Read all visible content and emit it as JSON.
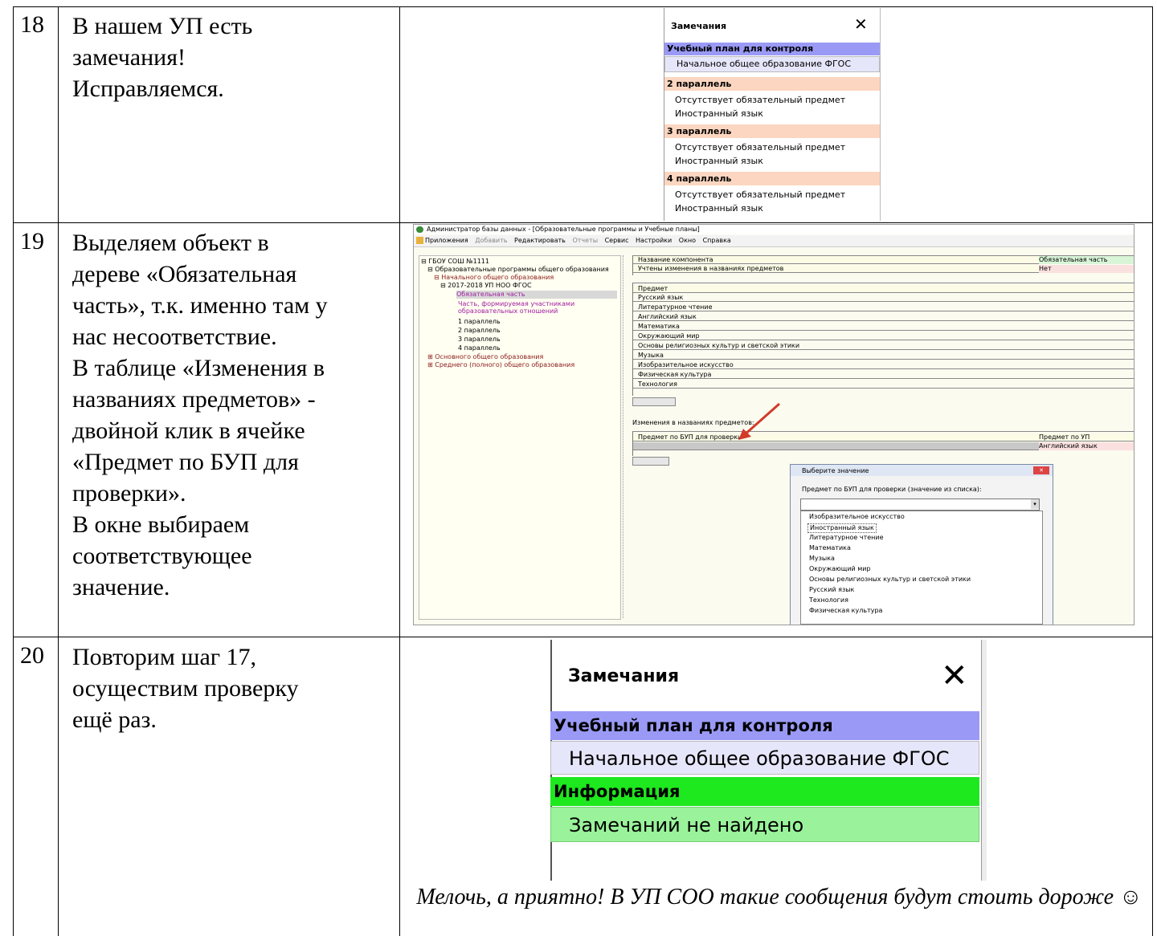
{
  "rows": [
    {
      "number": "18",
      "lines": [
        "В нашем УП есть",
        "замечания!",
        "Исправляемся."
      ]
    },
    {
      "number": "19",
      "lines": [
        "Выделяем объект в",
        "дереве «Обязательная",
        "часть», т.к. именно там у",
        "нас несоответствие.",
        "В таблице «Изменения в",
        "названиях предметов» -",
        "двойной клик в ячейке",
        "«Предмет по БУП для",
        "проверки».",
        "В окне выбираем",
        "соответствующее",
        "значение."
      ]
    },
    {
      "number": "20",
      "lines": [
        "Повторим шаг 17,",
        "осуществим проверку",
        "ещё раз."
      ]
    }
  ],
  "remarks1": {
    "title": "Замечания",
    "close": "✕",
    "plan_header": "Учебный план для контроля",
    "plan_value": "Начальное общее образование ФГОС",
    "groups": [
      {
        "header": "2 параллель",
        "line1": "Отсутствует обязательный предмет",
        "line2": "Иностранный язык"
      },
      {
        "header": "3 параллель",
        "line1": "Отсутствует обязательный предмет",
        "line2": "Иностранный язык"
      },
      {
        "header": "4 параллель",
        "line1": "Отсутствует обязательный предмет",
        "line2": "Иностранный язык"
      }
    ]
  },
  "admin": {
    "title": "Администратор базы данных - [Образовательные программы и Учебные планы]",
    "menu": [
      "Приложения",
      "Добавить",
      "Редактировать",
      "Отчеты",
      "Сервис",
      "Настройки",
      "Окно",
      "Справка"
    ],
    "tree": [
      "⊟ ГБОУ СОШ №1111",
      "⊟ Образовательные программы общего образования",
      "⊟ Начального общего образования",
      "⊟ 2017-2018 УП НОО ФГОС",
      "Обязательная часть",
      "Часть, формируемая участниками",
      "образовательных отношений",
      "1 параллель",
      "2 параллель",
      "3 параллель",
      "4 параллель",
      "⊞ Основного общего образования",
      "⊞ Среднего (полного) общего образования"
    ],
    "props": [
      {
        "name": "Название компонента",
        "value": "Обязательная часть"
      },
      {
        "name": "Учтены изменения в названиях предметов",
        "value": "Нет"
      }
    ],
    "subjects_header": "Предмет",
    "subjects": [
      "Русский язык",
      "Литературное чтение",
      "Английский язык",
      "Математика",
      "Окружающий мир",
      "Основы религиозных культур и светской этики",
      "Музыка",
      "Изобразительное искусство",
      "Физическая культура",
      "Технология"
    ],
    "changes_label": "Изменения в названиях предметов:",
    "changes_col1": "Предмет по БУП для проверки",
    "changes_col2": "Предмет по УП",
    "changes_value2": "Английский язык",
    "dialog_title": "Выберите значение",
    "dialog_label": "Предмет по БУП для проверки (значение из списка):",
    "options": [
      "Изобразительное искусство",
      "Иностранный язык",
      "Литературное чтение",
      "Математика",
      "Музыка",
      "Окружающий мир",
      "Основы религиозных культур и светской этики",
      "Русский язык",
      "Технология",
      "Физическая культура"
    ]
  },
  "remarks2": {
    "title": "Замечания",
    "close": "✕",
    "plan_header": "Учебный план для контроля",
    "plan_value": "Начальное общее образование ФГОС",
    "info_header": "Информация",
    "info_value": "Замечаний не найдено"
  },
  "caption": "Мелочь, а приятно! В УП СОО такие сообщения будут стоить дороже ☺",
  "colors": {
    "plan_header": "#9a9af6",
    "plan_value": "#e6e6fb",
    "group_header": "#fcd6c0",
    "info_header": "#1ee81e",
    "info_value": "#9af39a"
  }
}
